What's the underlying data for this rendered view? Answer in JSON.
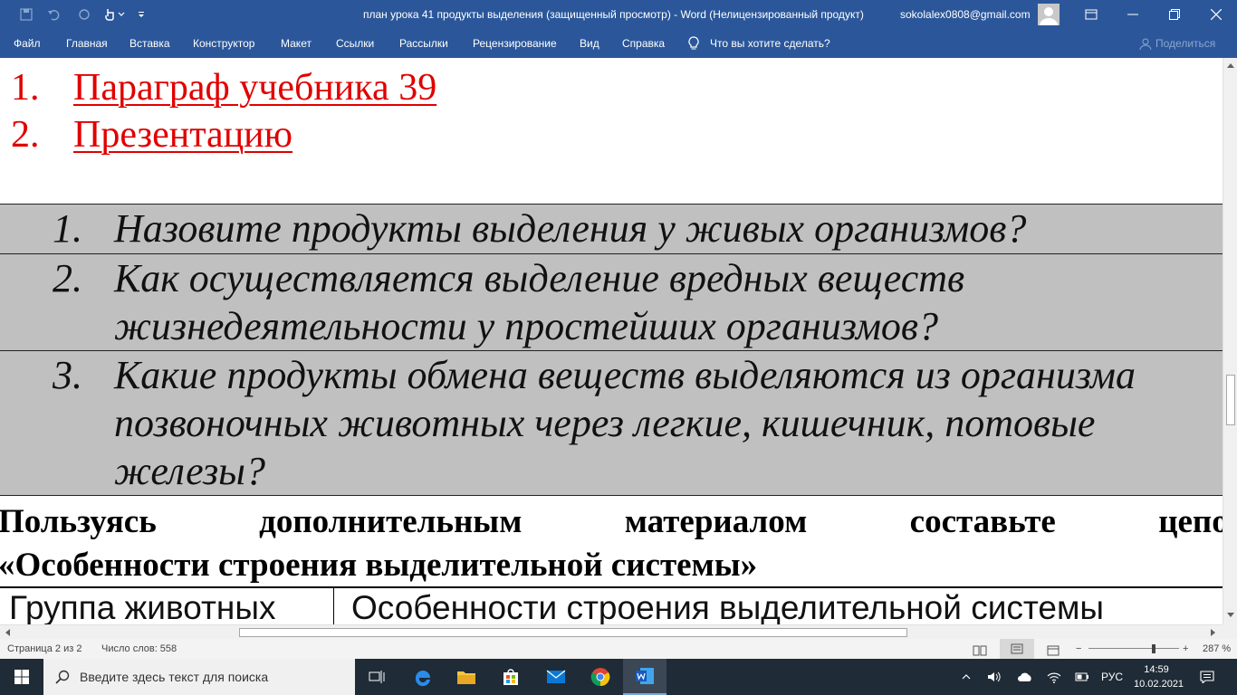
{
  "window": {
    "title": "план урока 41 продукты выделения (защищенный просмотр)  -  Word (Нелицензированный продукт)",
    "user_email": "sokolalex0808@gmail.com"
  },
  "ribbon": {
    "tabs": [
      "Файл",
      "Главная",
      "Вставка",
      "Конструктор",
      "Макет",
      "Ссылки",
      "Рассылки",
      "Рецензирование",
      "Вид",
      "Справка"
    ],
    "tell_me": "Что вы хотите сделать?",
    "share": "Поделиться"
  },
  "document": {
    "links": [
      {
        "num": "1.",
        "text": "Параграф учебника 39"
      },
      {
        "num": "2.",
        "text": "Презентацию"
      }
    ],
    "questions": [
      {
        "num": "1.",
        "lines": [
          "Назовите продукты выделения у живых организмов?"
        ]
      },
      {
        "num": "2.",
        "lines": [
          "Как осуществляется выделение вредных веществ",
          "жизнедеятельности у простейших организмов?"
        ]
      },
      {
        "num": "3.",
        "lines": [
          "Какие продукты обмена веществ выделяются из организма",
          "позвоночных животных через легкие, кишечник, потовые",
          "железы?"
        ]
      }
    ],
    "instruction_words": [
      "Пользуясь",
      "дополнительным",
      "материалом",
      "составьте",
      "цепочк"
    ],
    "instruction_line2": "«Особенности строения выделительной системы»",
    "table_headers": [
      "Группа животных",
      "Особенности строения выделительной системы"
    ]
  },
  "statusbar": {
    "page": "Страница 2 из 2",
    "words": "Число слов: 558",
    "zoom": "287 %"
  },
  "taskbar": {
    "search_placeholder": "Введите здесь текст для поиска",
    "lang": "РУС",
    "time": "14:59",
    "date": "10.02.2021"
  }
}
